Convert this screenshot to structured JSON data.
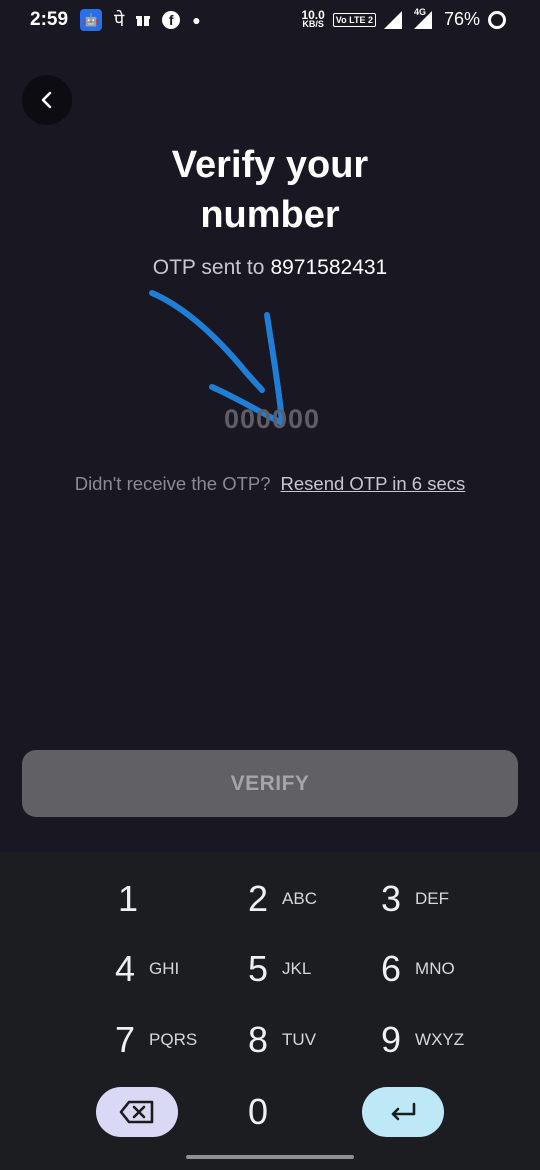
{
  "status_bar": {
    "time": "2:59",
    "notif_hindi": "पे",
    "speed_value": "10.0",
    "speed_unit": "KB/S",
    "volte_label": "Vo LTE 2",
    "network_type": "4G",
    "battery": "76%"
  },
  "header": {
    "title_line1": "Verify your",
    "title_line2": "number"
  },
  "otp": {
    "sent_to_label": "OTP sent to",
    "phone_number": "8971582431",
    "placeholder": "000000",
    "value": ""
  },
  "resend": {
    "question": "Didn't receive the OTP?",
    "link": "Resend OTP in 6 secs"
  },
  "verify_button": {
    "label": "VERIFY"
  },
  "keypad": {
    "keys": [
      {
        "digit": "1",
        "letters": ""
      },
      {
        "digit": "2",
        "letters": "ABC"
      },
      {
        "digit": "3",
        "letters": "DEF"
      },
      {
        "digit": "4",
        "letters": "GHI"
      },
      {
        "digit": "5",
        "letters": "JKL"
      },
      {
        "digit": "6",
        "letters": "MNO"
      },
      {
        "digit": "7",
        "letters": "PQRS"
      },
      {
        "digit": "8",
        "letters": "TUV"
      },
      {
        "digit": "9",
        "letters": "WXYZ"
      },
      {
        "digit": "0",
        "letters": ""
      }
    ],
    "backspace_color": "#d9d8f5",
    "enter_color": "#bde9f7"
  },
  "colors": {
    "background": "#181722",
    "annotation_stroke": "#1f7fd6",
    "verify_disabled": "#616064"
  }
}
